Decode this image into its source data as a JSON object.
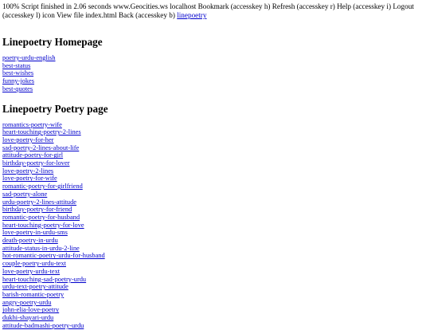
{
  "toolbar": {
    "status": "100% Script finished in 2.06 seconds",
    "site": "www.Geocities.ws",
    "host": "localhost",
    "bookmark": "Bookmark (accesskey h)",
    "refresh": "Refresh (accesskey r)",
    "help": "Help (accesskey i)",
    "logout": "Logout (accesskey l)",
    "icon_view": "icon View file index.html",
    "back": "Back (accesskey b)",
    "home_link": "linepoetry"
  },
  "home": {
    "title": "Linepoetry Homepage",
    "links": [
      "poetry-urdu-english",
      "best-status",
      "best-wishes",
      "funny-jokes",
      "best-quotes"
    ]
  },
  "poetry": {
    "title": "Linepoetry Poetry page",
    "links": [
      "romantics-poetry-wife",
      "heart-touching-poetry-2-lines",
      "love-poetry-for-her",
      "sad-poetry-2-lines-about-life",
      "attitude-poetry-for-girl",
      "birthday-poetry-for-lover",
      "love-poetry-2-lines",
      "love-poetry-for-wife",
      "romantic-poetry-for-girlfriend",
      "sad-poetry-alone",
      "urdu-poetry-2-lines-attitude",
      "birthday-poetry-for-friend",
      "romantic-poetry-for-husband",
      "heart-touching-poetry-for-love",
      "love-poetry-in-urdu-sms",
      "death-poetry-in-urdu",
      "attitude-status-in-urdu-2-line",
      "hot-romantic-poetry-urdu-for-husband",
      "couple-poetry-urdu-text",
      "love-poetry-urdu-text",
      "heart-touching-sad-poetry-urdu",
      "urdu-text-poetry-attitude",
      "barish-romantic-poetry",
      "angry-poetry-urdu",
      "john-elia-love-poetry",
      "dukhi-shayari-urdu",
      "attitude-badmashi-poetry-urdu"
    ]
  }
}
